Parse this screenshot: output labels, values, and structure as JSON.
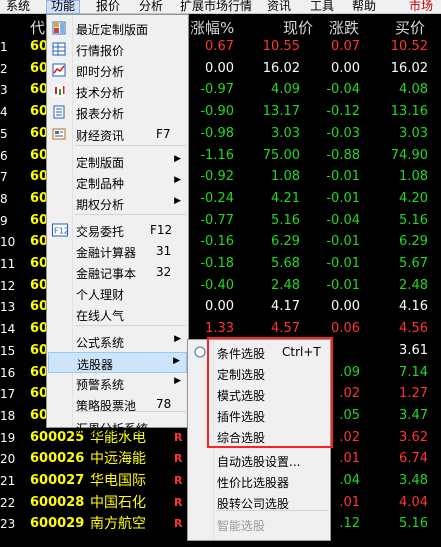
{
  "menubar": {
    "items": [
      "系统",
      "功能",
      "报价",
      "分析",
      "扩展市场行情",
      "资讯",
      "工具",
      "帮助"
    ],
    "active": "功能",
    "market_label": "市场"
  },
  "table": {
    "headers": [
      "代",
      "涨幅%",
      "现价",
      "涨跌",
      "买价"
    ],
    "rows": [
      {
        "idx": "1",
        "code": "60",
        "name": "",
        "pct": "0.67",
        "price": "10.55",
        "chg": "0.07",
        "bid": "10.52",
        "color": "red"
      },
      {
        "idx": "2",
        "code": "60",
        "name": "",
        "pct": "0.00",
        "price": "16.02",
        "chg": "0.00",
        "bid": "16.02",
        "color": "white"
      },
      {
        "idx": "3",
        "code": "60",
        "name": "",
        "pct": "-0.97",
        "price": "4.09",
        "chg": "-0.04",
        "bid": "4.08",
        "color": "green"
      },
      {
        "idx": "4",
        "code": "60",
        "name": "",
        "pct": "-0.90",
        "price": "13.17",
        "chg": "-0.12",
        "bid": "13.16",
        "color": "green"
      },
      {
        "idx": "5",
        "code": "60",
        "name": "",
        "pct": "-0.98",
        "price": "3.03",
        "chg": "-0.03",
        "bid": "3.03",
        "color": "green"
      },
      {
        "idx": "6",
        "code": "60",
        "name": "",
        "pct": "-1.16",
        "price": "75.00",
        "chg": "-0.88",
        "bid": "74.90",
        "color": "green"
      },
      {
        "idx": "7",
        "code": "60",
        "name": "",
        "pct": "-0.92",
        "price": "1.08",
        "chg": "-0.01",
        "bid": "1.08",
        "color": "green"
      },
      {
        "idx": "8",
        "code": "60",
        "name": "",
        "pct": "-0.24",
        "price": "4.21",
        "chg": "-0.01",
        "bid": "4.20",
        "color": "green"
      },
      {
        "idx": "9",
        "code": "60",
        "name": "",
        "pct": "-0.77",
        "price": "5.16",
        "chg": "-0.04",
        "bid": "5.16",
        "color": "green"
      },
      {
        "idx": "10",
        "code": "60",
        "name": "",
        "pct": "-0.16",
        "price": "6.29",
        "chg": "-0.01",
        "bid": "6.29",
        "color": "green"
      },
      {
        "idx": "11",
        "code": "60",
        "name": "",
        "pct": "-0.18",
        "price": "5.68",
        "chg": "-0.01",
        "bid": "5.67",
        "color": "green"
      },
      {
        "idx": "12",
        "code": "60",
        "name": "",
        "pct": "-0.40",
        "price": "2.48",
        "chg": "-0.01",
        "bid": "2.48",
        "color": "green"
      },
      {
        "idx": "13",
        "code": "60",
        "name": "",
        "pct": "0.00",
        "price": "4.17",
        "chg": "0.00",
        "bid": "4.16",
        "color": "white"
      },
      {
        "idx": "14",
        "code": "60",
        "name": "",
        "pct": "1.33",
        "price": "4.57",
        "chg": "0.06",
        "bid": "4.56",
        "color": "red"
      },
      {
        "idx": "15",
        "code": "60",
        "name": "",
        "pct": "",
        "price": "",
        "chg": "",
        "bid": "3.61",
        "color": "white"
      },
      {
        "idx": "16",
        "code": "60",
        "name": "",
        "pct": "",
        "price": "",
        "chg": ".09",
        "bid": "7.14",
        "color": "green"
      },
      {
        "idx": "17",
        "code": "60",
        "name": "",
        "pct": "",
        "price": "",
        "chg": ".02",
        "bid": "1.27",
        "color": "red"
      },
      {
        "idx": "18",
        "code": "60",
        "name": "",
        "pct": "",
        "price": "",
        "chg": ".05",
        "bid": "3.47",
        "color": "green"
      },
      {
        "idx": "19",
        "code": "600025",
        "name": "华能水电",
        "pct": "",
        "price": "",
        "chg": ".02",
        "bid": "3.62",
        "color": "red"
      },
      {
        "idx": "20",
        "code": "600026",
        "name": "中远海能",
        "pct": "",
        "price": "",
        "chg": ".01",
        "bid": "6.74",
        "color": "red"
      },
      {
        "idx": "21",
        "code": "600027",
        "name": "华电国际",
        "pct": "",
        "price": "",
        "chg": ".04",
        "bid": "3.48",
        "color": "green"
      },
      {
        "idx": "22",
        "code": "600028",
        "name": "中国石化",
        "pct": "",
        "price": "",
        "chg": ".01",
        "bid": "4.04",
        "color": "red"
      },
      {
        "idx": "23",
        "code": "600029",
        "name": "南方航空",
        "pct": "",
        "price": "",
        "chg": ".12",
        "bid": "5.16",
        "color": "green"
      }
    ],
    "r_marker": "R"
  },
  "menu_main": {
    "items": [
      {
        "label": "最近定制版面",
        "shortcut": "",
        "icon": "layout-icon",
        "arrow": false
      },
      {
        "label": "行情报价",
        "shortcut": "",
        "icon": "quote-table-icon",
        "arrow": false
      },
      {
        "label": "即时分析",
        "shortcut": "",
        "icon": "line-chart-icon",
        "arrow": false
      },
      {
        "label": "技术分析",
        "shortcut": "",
        "icon": "candlestick-icon",
        "arrow": false
      },
      {
        "label": "报表分析",
        "shortcut": "",
        "icon": "report-icon",
        "arrow": false
      },
      {
        "label": "财经资讯",
        "shortcut": "F7",
        "icon": "news-icon",
        "arrow": false
      },
      {
        "label": "定制版面",
        "shortcut": "",
        "icon": "",
        "arrow": true
      },
      {
        "label": "定制品种",
        "shortcut": "",
        "icon": "",
        "arrow": true
      },
      {
        "label": "期权分析",
        "shortcut": "",
        "icon": "",
        "arrow": true
      },
      {
        "label": "交易委托",
        "shortcut": "F12",
        "icon": "f12-icon",
        "arrow": false
      },
      {
        "label": "金融计算器",
        "shortcut": "31",
        "icon": "",
        "arrow": false
      },
      {
        "label": "金融记事本",
        "shortcut": "32",
        "icon": "",
        "arrow": false
      },
      {
        "label": "个人理财",
        "shortcut": "",
        "icon": "",
        "arrow": false
      },
      {
        "label": "在线人气",
        "shortcut": "",
        "icon": "",
        "arrow": false
      },
      {
        "label": "公式系统",
        "shortcut": "",
        "icon": "",
        "arrow": true
      },
      {
        "label": "选股器",
        "shortcut": "",
        "icon": "",
        "arrow": true
      },
      {
        "label": "预警系统",
        "shortcut": "",
        "icon": "",
        "arrow": true
      },
      {
        "label": "策略股票池",
        "shortcut": "78",
        "icon": "",
        "arrow": false
      },
      {
        "label": "汇恩分析系统",
        "shortcut": "",
        "icon": "",
        "arrow": false
      }
    ]
  },
  "menu_sub": {
    "items": [
      {
        "label": "条件选股",
        "shortcut": "Ctrl+T",
        "icon": "radio-icon",
        "disabled": false
      },
      {
        "label": "定制选股",
        "shortcut": "",
        "icon": "",
        "disabled": false
      },
      {
        "label": "模式选股",
        "shortcut": "",
        "icon": "",
        "disabled": false
      },
      {
        "label": "插件选股",
        "shortcut": "",
        "icon": "",
        "disabled": false
      },
      {
        "label": "综合选股",
        "shortcut": "",
        "icon": "",
        "disabled": false
      },
      {
        "label": "自动选股设置...",
        "shortcut": "",
        "icon": "",
        "disabled": false
      },
      {
        "label": "性价比选股器",
        "shortcut": "",
        "icon": "",
        "disabled": false
      },
      {
        "label": "股转公司选股",
        "shortcut": "",
        "icon": "",
        "disabled": false
      },
      {
        "label": "智能选股",
        "shortcut": "",
        "icon": "",
        "disabled": true
      }
    ]
  },
  "colors": {
    "up": "#ff3333",
    "down": "#22d822",
    "flat": "#ffffff",
    "code": "#ffff00",
    "highlight_box": "#ff2020"
  }
}
